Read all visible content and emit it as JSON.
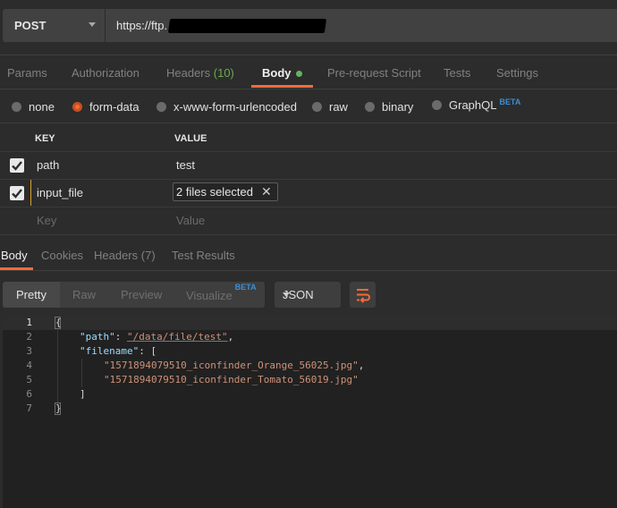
{
  "request": {
    "method": "POST",
    "url": "https://ftp."
  },
  "request_tabs": [
    {
      "label": "Params"
    },
    {
      "label": "Authorization"
    },
    {
      "label": "Headers",
      "count": "(10)"
    },
    {
      "label": "Body",
      "active": true
    },
    {
      "label": "Pre-request Script"
    },
    {
      "label": "Tests"
    },
    {
      "label": "Settings"
    }
  ],
  "body_types": [
    {
      "label": "none"
    },
    {
      "label": "form-data",
      "selected": true
    },
    {
      "label": "x-www-form-urlencoded"
    },
    {
      "label": "raw"
    },
    {
      "label": "binary"
    },
    {
      "label": "GraphQL",
      "badge": "BETA"
    }
  ],
  "form_table": {
    "headers": {
      "key": "KEY",
      "value": "VALUE"
    },
    "rows": [
      {
        "checked": true,
        "key": "path",
        "value": "test"
      },
      {
        "checked": true,
        "key": "input_file",
        "value": "2 files selected"
      }
    ],
    "placeholder": {
      "key": "Key",
      "value": "Value"
    }
  },
  "response_tabs": [
    {
      "label": "Body",
      "active": true
    },
    {
      "label": "Cookies"
    },
    {
      "label": "Headers",
      "count": "(7)"
    },
    {
      "label": "Test Results"
    }
  ],
  "view_modes": [
    {
      "label": "Pretty",
      "active": true
    },
    {
      "label": "Raw"
    },
    {
      "label": "Preview"
    },
    {
      "label": "Visualize",
      "badge": "BETA"
    }
  ],
  "format": "JSON",
  "response_lines": [
    "1",
    "2",
    "3",
    "4",
    "5",
    "6",
    "7"
  ],
  "response": {
    "open_brace": "{",
    "path_key": "\"path\"",
    "path_value": "\"/data/file/test\"",
    "filename_key": "\"filename\"",
    "file1": "\"1571894079510_iconfinder_Orange_56025.jpg\"",
    "file2": "\"1571894079510_iconfinder_Tomato_56019.jpg\"",
    "close_bracket": "]",
    "close_brace": "}"
  },
  "colors": {
    "accent": "#f26b3a",
    "count_green": "#6bab4e",
    "beta_blue": "#3b8fd6",
    "json_key": "#9cdcfe",
    "json_string": "#ce9178"
  },
  "icons": [
    "caret-down-icon",
    "checkbox-checked-icon",
    "close-icon",
    "wrap-lines-icon"
  ]
}
